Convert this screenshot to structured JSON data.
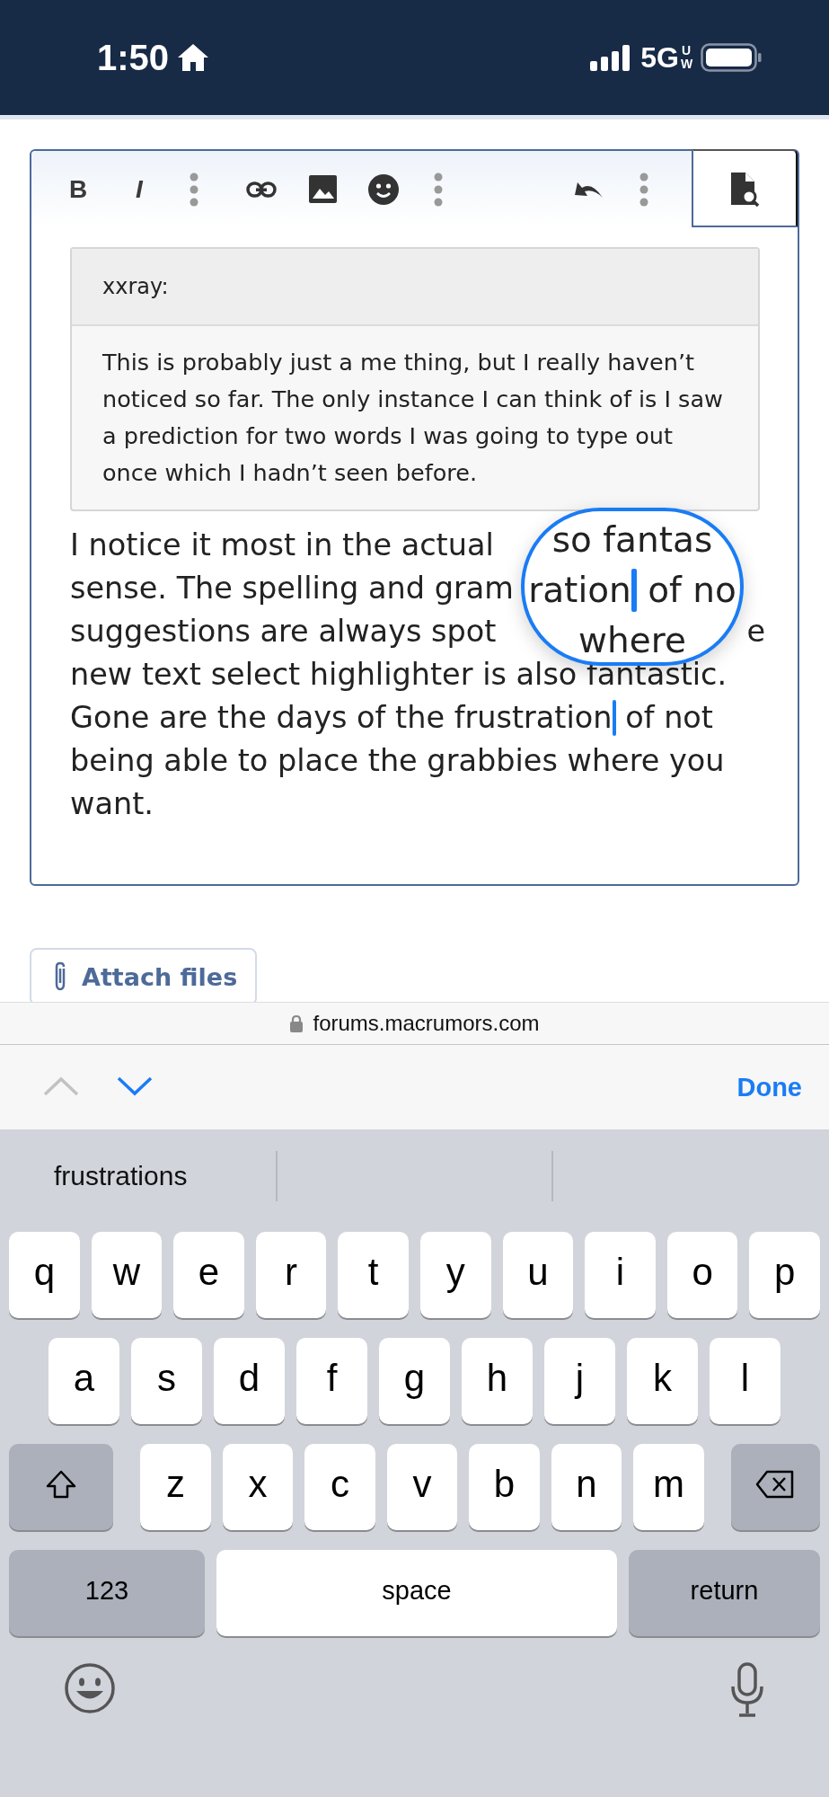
{
  "status_bar": {
    "time": "1:50",
    "network": "5G",
    "network_badge": "UW"
  },
  "editor": {
    "toolbar": [
      {
        "kind": "bold",
        "label": "B"
      },
      {
        "kind": "italic",
        "label": "I"
      },
      {
        "kind": "more"
      },
      {
        "kind": "link"
      },
      {
        "kind": "image"
      },
      {
        "kind": "emoji"
      },
      {
        "kind": "more"
      },
      {
        "kind": "spacer"
      },
      {
        "kind": "undo"
      },
      {
        "kind": "more"
      }
    ],
    "quote": {
      "author": "xxray:",
      "text": "This is probably just a me thing, but I really haven’t noticed so far. The only instance I can think of is I saw a prediction for two words I was going to type out once which I hadn’t seen before."
    },
    "lines": [
      {
        "text": "I notice it most in the actual"
      },
      {
        "text": "sense. The spelling and gram"
      },
      {
        "text": "suggestions are always spot",
        "tail": "e"
      },
      {
        "text": "new text select highlighter is also fantastic."
      },
      {
        "text": "Gone are the days of the frustration",
        "after_cursor": " of not"
      },
      {
        "text": "being able to place the grabbies where you"
      },
      {
        "text": "want."
      }
    ],
    "loupe": {
      "lines": [
        {
          "text": "so fantas"
        },
        {
          "text": "ration",
          "after_cursor": " of no"
        },
        {
          "text": "where"
        }
      ]
    }
  },
  "attach_button": "Attach files",
  "url_bar": {
    "address": "forums.macrumors.com"
  },
  "accessory_bar": {
    "previous_disabled": true,
    "next_disabled": false,
    "done": "Done"
  },
  "keyboard": {
    "suggestions": [
      "frustrations"
    ],
    "rows": [
      {
        "keys": [
          {
            "kind": "letter",
            "label": "q"
          },
          {
            "kind": "letter",
            "label": "w"
          },
          {
            "kind": "letter",
            "label": "e"
          },
          {
            "kind": "letter",
            "label": "r"
          },
          {
            "kind": "letter",
            "label": "t"
          },
          {
            "kind": "letter",
            "label": "y"
          },
          {
            "kind": "letter",
            "label": "u"
          },
          {
            "kind": "letter",
            "label": "i"
          },
          {
            "kind": "letter",
            "label": "o"
          },
          {
            "kind": "letter",
            "label": "p"
          }
        ]
      },
      {
        "keys": [
          {
            "kind": "letter",
            "label": "a"
          },
          {
            "kind": "letter",
            "label": "s"
          },
          {
            "kind": "letter",
            "label": "d"
          },
          {
            "kind": "letter",
            "label": "f"
          },
          {
            "kind": "letter",
            "label": "g"
          },
          {
            "kind": "letter",
            "label": "h"
          },
          {
            "kind": "letter",
            "label": "j"
          },
          {
            "kind": "letter",
            "label": "k"
          },
          {
            "kind": "letter",
            "label": "l"
          }
        ]
      },
      {
        "keys": [
          {
            "kind": "shift"
          },
          {
            "kind": "letter",
            "label": "z"
          },
          {
            "kind": "letter",
            "label": "x"
          },
          {
            "kind": "letter",
            "label": "c"
          },
          {
            "kind": "letter",
            "label": "v"
          },
          {
            "kind": "letter",
            "label": "b"
          },
          {
            "kind": "letter",
            "label": "n"
          },
          {
            "kind": "letter",
            "label": "m"
          },
          {
            "kind": "delete"
          }
        ]
      },
      {
        "keys": [
          {
            "kind": "mode",
            "label": "123"
          },
          {
            "kind": "space",
            "label": "space"
          },
          {
            "kind": "return",
            "label": "return"
          }
        ]
      }
    ]
  }
}
